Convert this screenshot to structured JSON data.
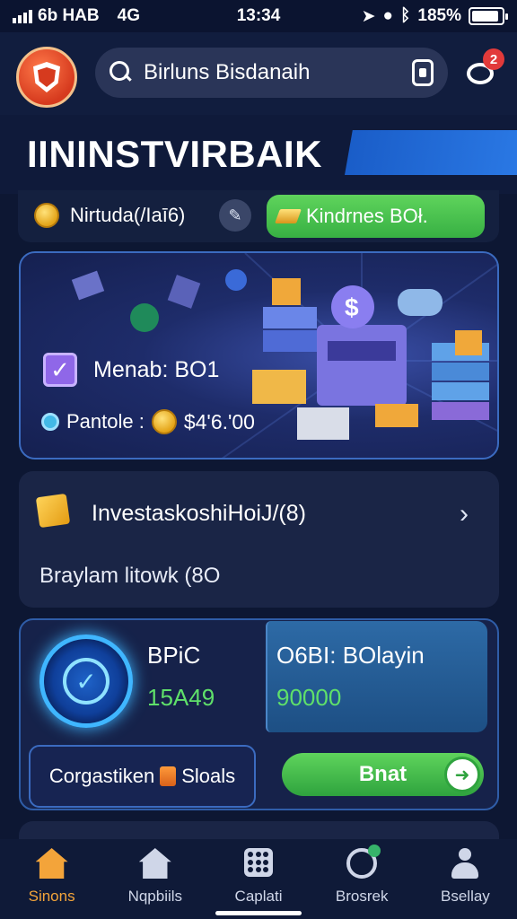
{
  "status_bar": {
    "carrier": "6b HAB",
    "network": "4G",
    "time": "13:34",
    "battery": "185%",
    "battery_level": 0.9
  },
  "header": {
    "search_text": "Birluns Bisdanaih",
    "notification_count": "2"
  },
  "title": "IININSTVIRBAIK",
  "row1": {
    "info_text": "Nirtuda(/Iaī6)",
    "green_pill": "Kindrnes BOł."
  },
  "banner": {
    "line1": "Menab: BO1",
    "portfolio_label": "Pantole :",
    "portfolio_value": "$4ʹ6.ʹ00"
  },
  "invest_card": {
    "title": "InvestaskoshiHoiJ/(8)",
    "subtitle": "Braylam litowk (8O"
  },
  "bpc_card": {
    "label": "BPiC",
    "value": "15A49",
    "panel_label": "O6BI: BOlayin",
    "panel_value": "90000",
    "compare_left": "Corgastiken",
    "compare_right": "Sloals",
    "buy_label": "Bnat"
  },
  "bottom_nav": [
    {
      "label": "Sinons",
      "icon": "home-icon",
      "active": true
    },
    {
      "label": "Nqpbiils",
      "icon": "house-outline-icon",
      "active": false
    },
    {
      "label": "Caplati",
      "icon": "dice-icon",
      "active": false
    },
    {
      "label": "Brosrek",
      "icon": "ring-icon",
      "active": false
    },
    {
      "label": "Bsellay",
      "icon": "person-icon",
      "active": false
    }
  ],
  "colors": {
    "background": "#0d1733",
    "accent_green": "#37b043",
    "accent_blue": "#1a5dc8",
    "active_nav": "#f3a43a"
  }
}
